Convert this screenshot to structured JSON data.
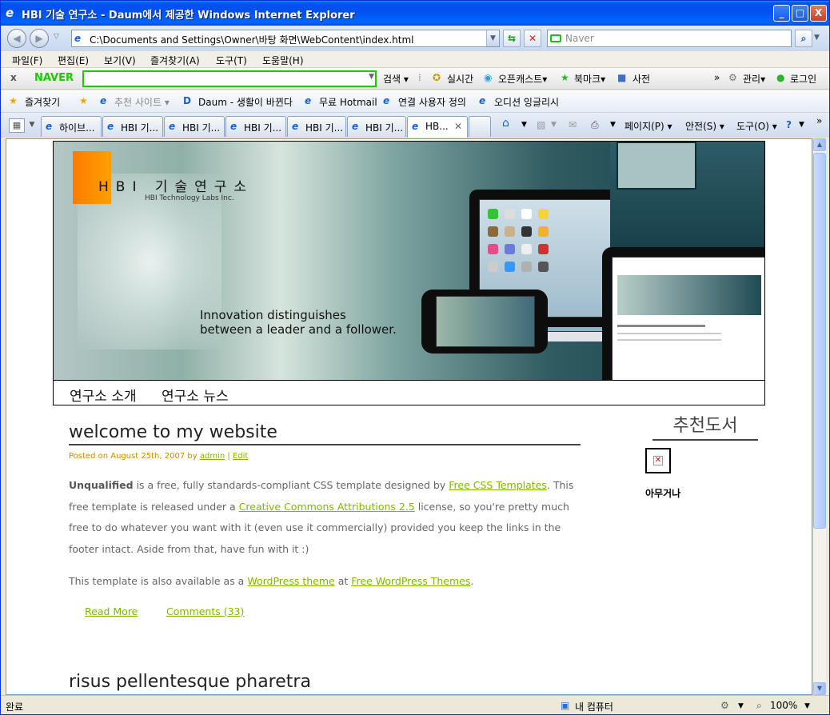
{
  "window": {
    "title": "HBI 기술 연구소 - Daum에서 제공한 Windows Internet Explorer",
    "min": "_",
    "max": "□",
    "close": "X"
  },
  "address": {
    "url": "C:\\Documents and Settings\\Owner\\바탕 화면\\WebContent\\index.html",
    "search_placeholder": "Naver"
  },
  "menu": [
    "파일(F)",
    "편집(E)",
    "보기(V)",
    "즐겨찾기(A)",
    "도구(T)",
    "도움말(H)"
  ],
  "naver_toolbar": {
    "close": "x",
    "logo": "NAVER",
    "items": [
      "검색 ▾",
      "실시간",
      "오픈캐스트▾",
      "북마크▾",
      "사전",
      "관리▾",
      "로그인"
    ]
  },
  "favorites_bar": {
    "label": "즐겨찾기",
    "items": [
      "추천 사이트 ▾",
      "Daum - 생활이 바뀐다",
      "무료 Hotmail",
      "연결 사용자 정의",
      "오디션 잉글리시"
    ]
  },
  "tabs": [
    "하이브...",
    "HBI 기...",
    "HBI 기...",
    "HBI 기...",
    "HBI 기...",
    "HBI 기...",
    "HB..."
  ],
  "command_bar": [
    "페이지(P) ▾",
    "안전(S) ▾",
    "도구(O) ▾"
  ],
  "page": {
    "logo_letters": "HBI 기술연구소",
    "logo_sub": "HBI Technology Labs Inc.",
    "tagline_1": "Innovation distinguishes",
    "tagline_2": "between a leader and a follower.",
    "nav": [
      "연구소 소개",
      "연구소 뉴스"
    ],
    "post1": {
      "title": "welcome to my website",
      "meta_prefix": "Posted on August 25th, 2007 by",
      "meta_author": "admin",
      "meta_sep": "|",
      "meta_edit": "Edit",
      "p1_b": "Unqualified",
      "p1_a": " is a free, fully standards-compliant CSS template designed by ",
      "p1_link1": "Free CSS Templates",
      "p1_c": ". This free template is released under a ",
      "p1_link2": "Creative Commons Attributions 2.5",
      "p1_d": " license, so you're pretty much free to do whatever you want with it (even use it commercially) provided you keep the links in the footer intact. Aside from that, have fun with it :)",
      "p2_a": "This template is also available as a ",
      "p2_link1": "WordPress theme",
      "p2_b": " at ",
      "p2_link2": "Free WordPress Themes",
      "p2_c": ".",
      "read_more": "Read More",
      "comments": "Comments (33)"
    },
    "post2_title": "risus pellentesque pharetra",
    "sidebar_title": "추천도서",
    "sidebar_caption": "아무거나"
  },
  "status": {
    "left": "완료",
    "zone": "내 컴퓨터",
    "zoom": "100%"
  }
}
